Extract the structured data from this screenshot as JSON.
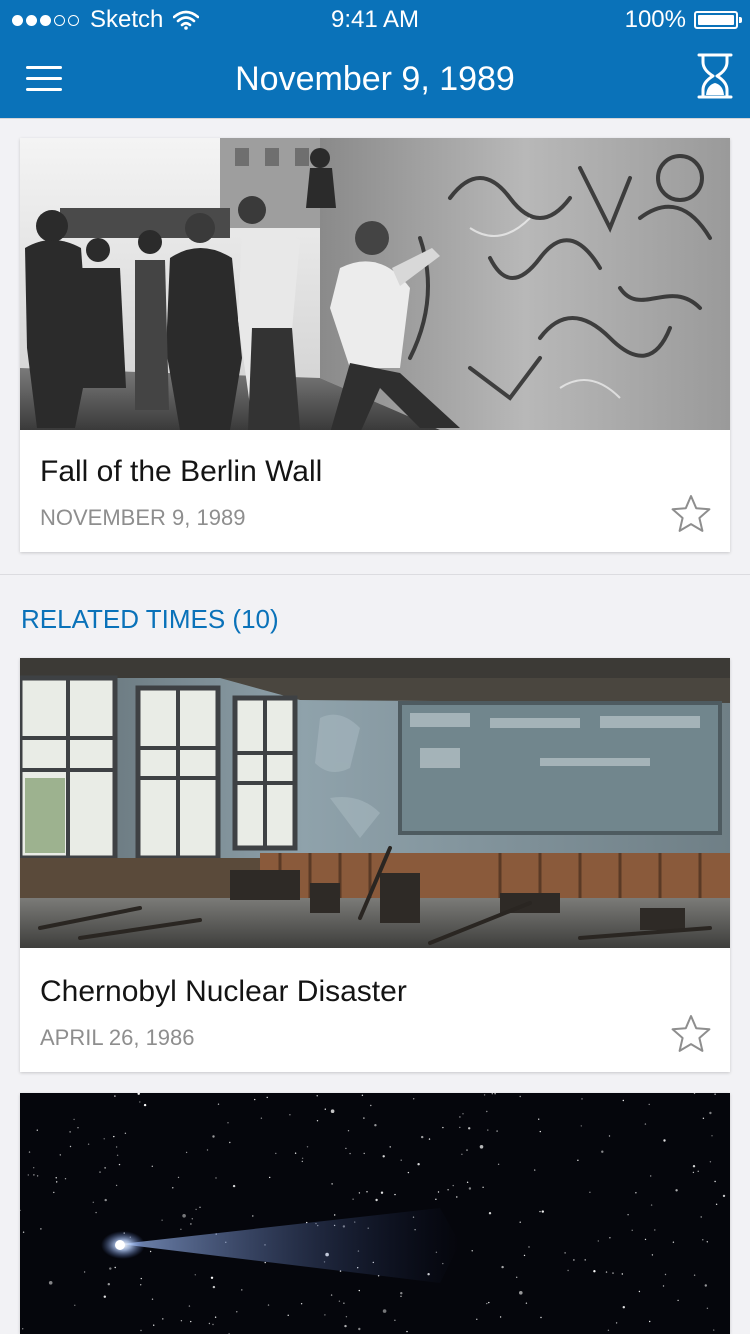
{
  "status_bar": {
    "carrier": "Sketch",
    "time": "9:41 AM",
    "battery": "100%",
    "battery_level": 1.0,
    "signal_bars_filled": 3,
    "signal_bars_total": 5
  },
  "nav": {
    "title": "November 9, 1989",
    "menu_icon": "hamburger-menu-icon",
    "right_icon": "hourglass-icon"
  },
  "featured": {
    "title": "Fall of the Berlin Wall",
    "date": "NOVEMBER 9, 1989",
    "image": "berlin-wall-photo",
    "favorite_icon": "star-outline-icon"
  },
  "related": {
    "header": "RELATED TIMES (10)",
    "items": [
      {
        "title": "Chernobyl Nuclear Disaster",
        "date": "APRIL 26, 1986",
        "image": "chernobyl-classroom-photo",
        "favorite_icon": "star-outline-icon"
      },
      {
        "title": "",
        "date": "",
        "image": "comet-night-sky-photo"
      }
    ]
  },
  "colors": {
    "brand": "#0a72b9",
    "background": "#f2f2f5",
    "card": "#ffffff",
    "title_text": "#141414",
    "date_text": "#8e8e8e"
  }
}
